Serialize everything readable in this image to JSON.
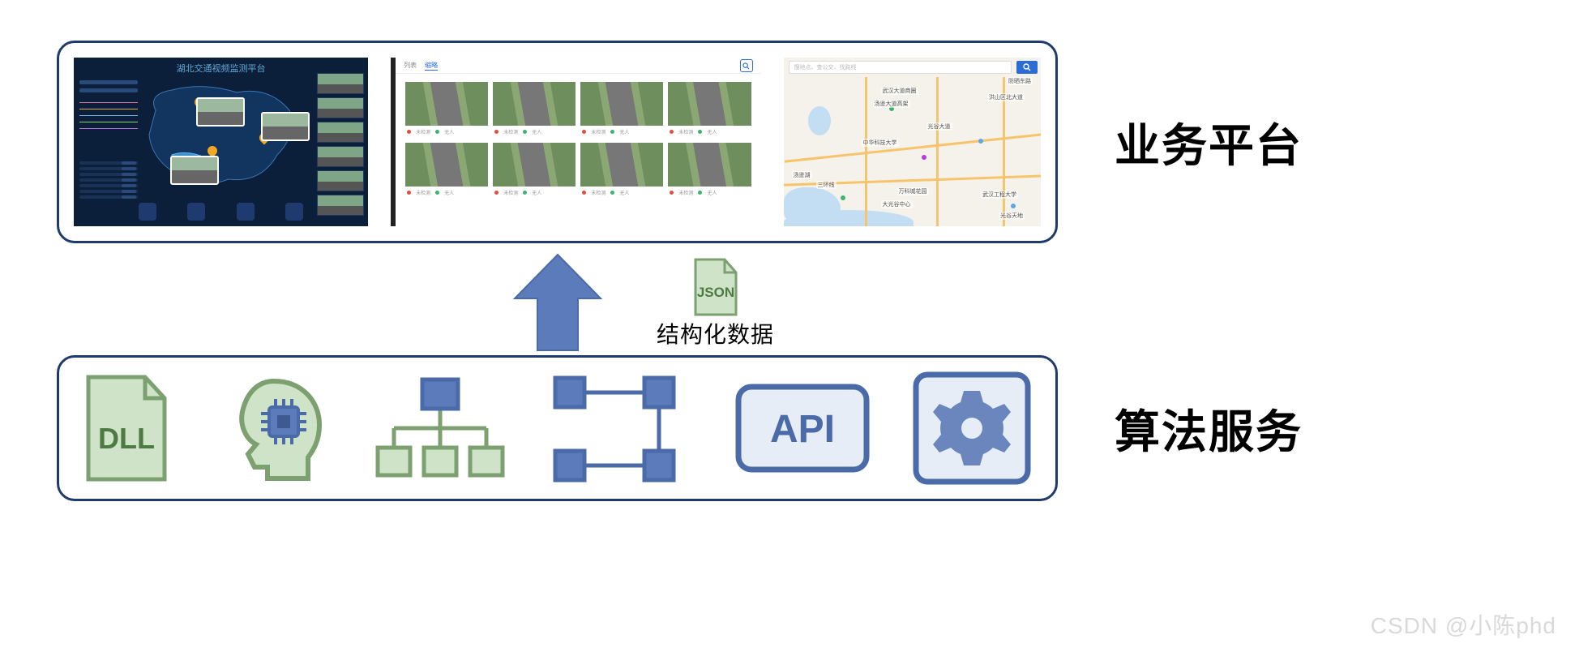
{
  "labels": {
    "business_platform": "业务平台",
    "algo_service": "算法服务",
    "structured_data": "结构化数据"
  },
  "icons": {
    "json_file": "JSON",
    "dll_file": "DLL",
    "api_box": "API"
  },
  "top_panel": {
    "dashboard_title": "湖北交通视频监测平台",
    "gallery": {
      "tabs": [
        "列表",
        "缩略"
      ],
      "card_meta": {
        "label1": "未检测",
        "label2": "无人"
      },
      "dot_colors": [
        "#e04f3c",
        "#3cb46e"
      ]
    },
    "map": {
      "search_placeholder": "搜地点、查公交、找路线",
      "pois": [
        "防晒东路",
        "汤逊湖",
        "三环线",
        "光谷大道",
        "武汉大道商圈",
        "汤逊大道高架",
        "洪山区北大道",
        "中华科技大学",
        "万科城花园",
        "大光谷中心",
        "武汉工程大学",
        "光谷天地"
      ]
    }
  },
  "bottom_icons": [
    "dll-file",
    "ai-head-chip",
    "tree-hierarchy",
    "process-flow",
    "api-box",
    "gear-settings"
  ],
  "watermark": "CSDN @小陈phd",
  "colors": {
    "border_navy": "#1f3a6e",
    "blue_fill": "#5b7bbb",
    "blue_stroke": "#4a6aa8",
    "green_fill": "#cfe3c9",
    "green_stroke": "#7ca06f",
    "gear_fill": "#6a86bd"
  }
}
